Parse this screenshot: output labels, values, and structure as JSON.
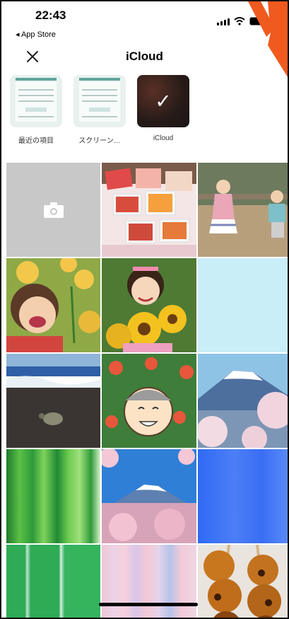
{
  "status_bar": {
    "time": "22:43",
    "back_app": "◂ App Store"
  },
  "header": {
    "title": "iCloud",
    "close_icon": "close-icon"
  },
  "albums": [
    {
      "label": "最近の項目",
      "selected": false
    },
    {
      "label": "スクリーン…",
      "selected": false
    },
    {
      "label": "iCloud",
      "selected": true
    }
  ],
  "photos": [
    {
      "subject": "camera"
    },
    {
      "subject": "food-boxes"
    },
    {
      "subject": "children-running"
    },
    {
      "subject": "girl-sunflowers"
    },
    {
      "subject": "girl-sunflower-bouquet"
    },
    {
      "subject": "light-blue"
    },
    {
      "subject": "turtle-beach"
    },
    {
      "subject": "cartoon-face"
    },
    {
      "subject": "mount-fuji-sakura"
    },
    {
      "subject": "green-stripes"
    },
    {
      "subject": "mount-fuji-blue-sky"
    },
    {
      "subject": "blue"
    },
    {
      "subject": "green-stripes-2"
    },
    {
      "subject": "pink-stripes"
    },
    {
      "subject": "dango"
    }
  ],
  "colors": {
    "accent_orange": "#f05a1e",
    "camera_tile": "#c8c8c8"
  }
}
